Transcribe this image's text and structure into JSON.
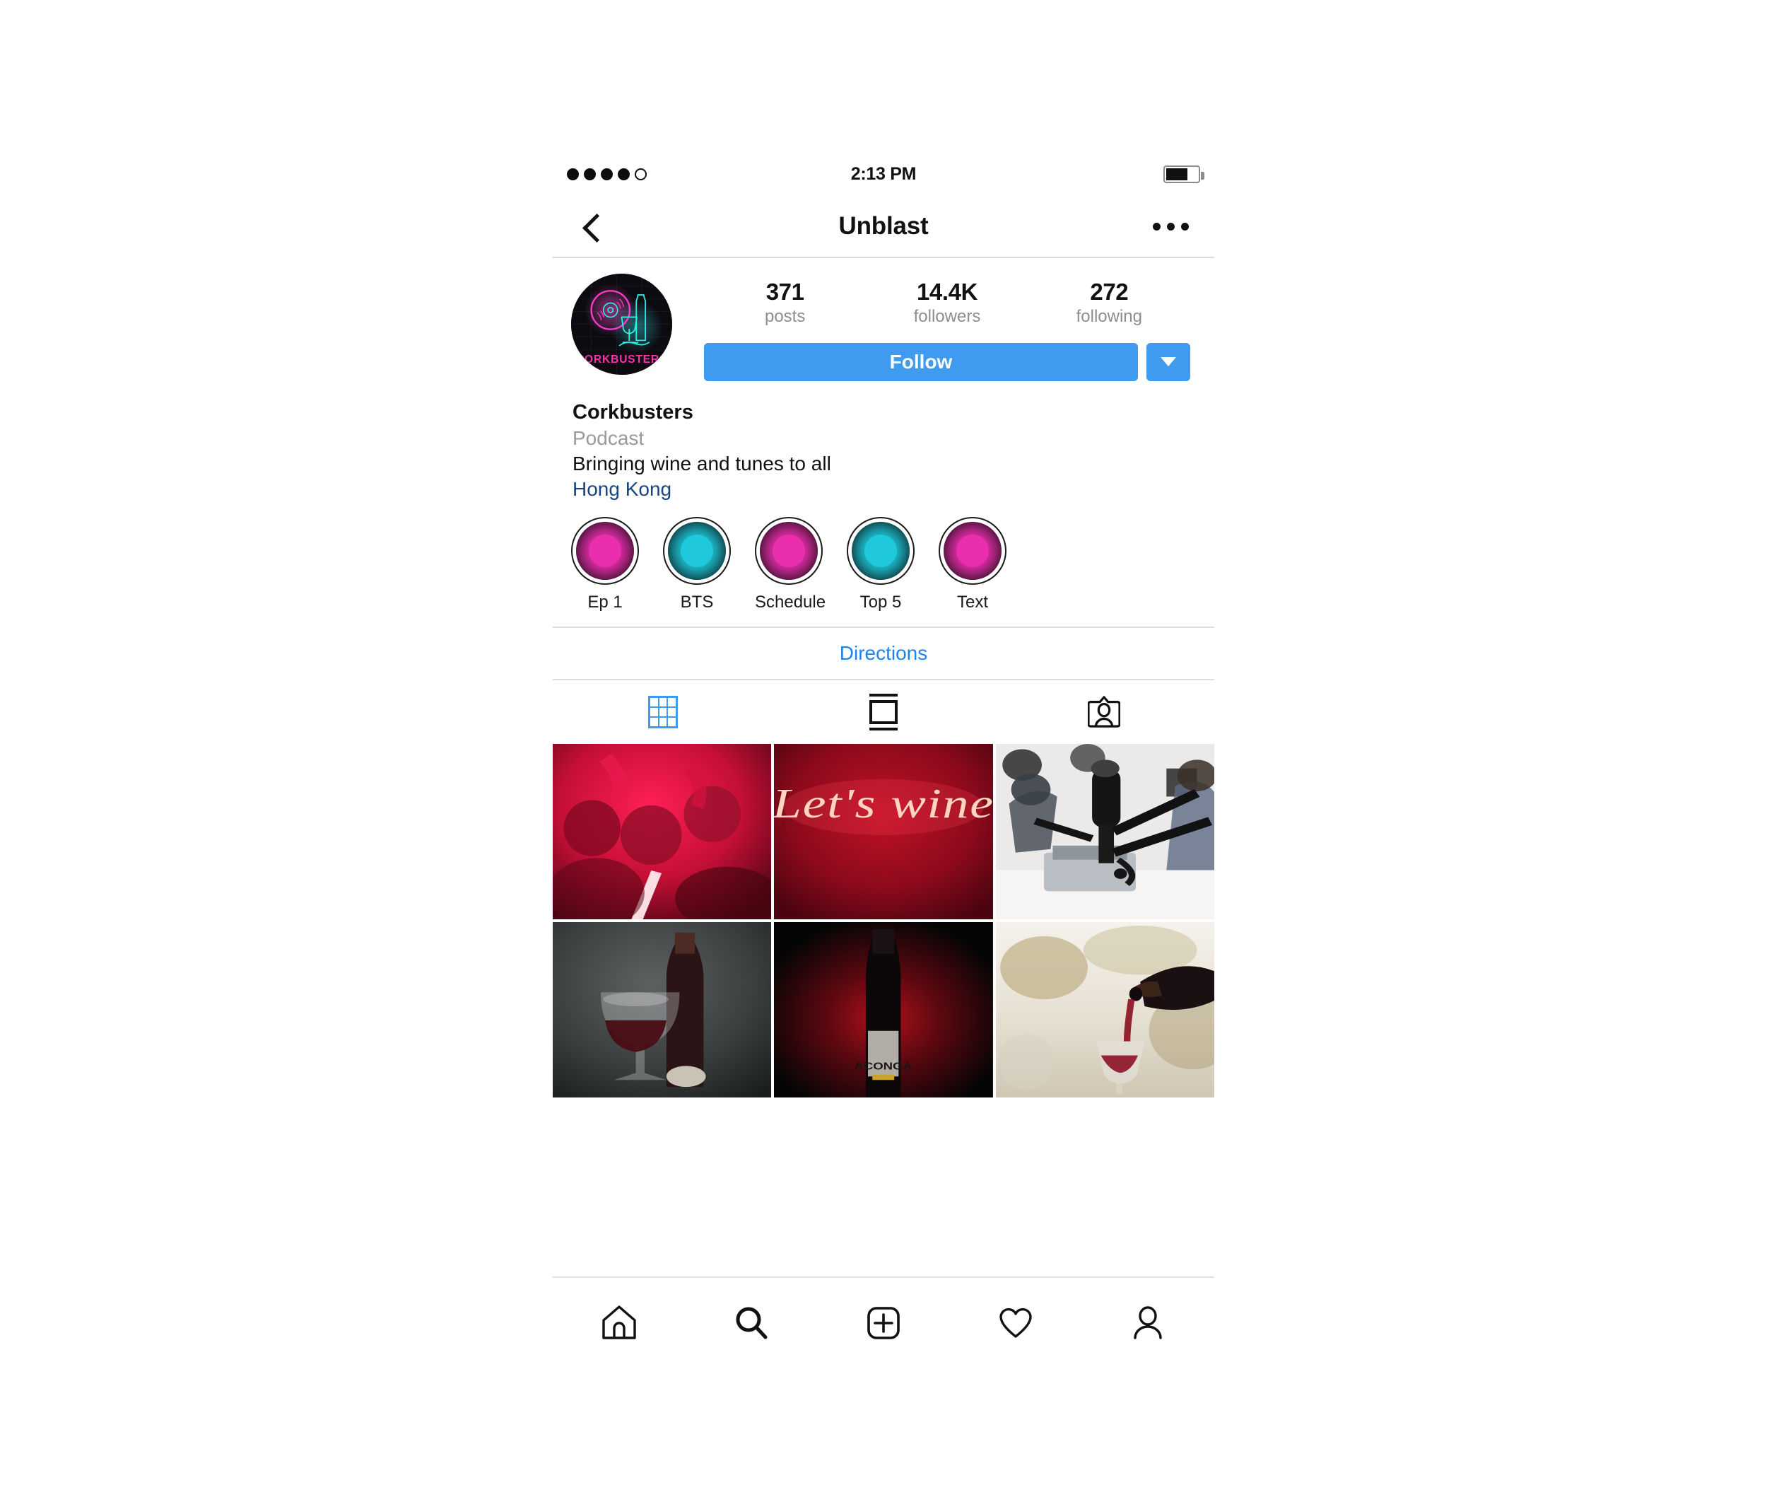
{
  "status_bar": {
    "signal_dots_filled": 4,
    "signal_dots_total": 5,
    "time": "2:13 PM",
    "battery_percent": 62
  },
  "nav_bar": {
    "back_icon": "chevron-left-icon",
    "title": "Unblast",
    "more_icon": "more-horizontal-icon"
  },
  "profile": {
    "avatar_alt": "Corkbusters neon logo",
    "avatar_brand_text": "CORKBUSTERS",
    "stats": [
      {
        "value": "371",
        "label": "posts"
      },
      {
        "value": "14.4K",
        "label": "followers"
      },
      {
        "value": "272",
        "label": "following"
      }
    ],
    "follow_label": "Follow",
    "dropdown_icon": "caret-down-icon",
    "name": "Corkbusters",
    "category": "Podcast",
    "bio": "Bringing wine and tunes to all",
    "location": "Hong Kong"
  },
  "highlights": [
    {
      "label": "Ep 1",
      "color": "#ea2fae"
    },
    {
      "label": "BTS",
      "color": "#1fc8da"
    },
    {
      "label": "Schedule",
      "color": "#ea2fae"
    },
    {
      "label": "Top 5",
      "color": "#1fc8da"
    },
    {
      "label": "Text",
      "color": "#ea2fae"
    }
  ],
  "directions": {
    "label": "Directions"
  },
  "tabs": [
    {
      "name": "grid",
      "icon": "grid-icon",
      "active": true
    },
    {
      "name": "reels",
      "icon": "reels-icon",
      "active": false
    },
    {
      "name": "tagged",
      "icon": "tagged-icon",
      "active": false
    }
  ],
  "posts": [
    {
      "name": "party-crowd-red-light",
      "caption": ""
    },
    {
      "name": "lets-wine-neon-sign",
      "caption": "Let's wine"
    },
    {
      "name": "podcast-studio-microphone",
      "caption": ""
    },
    {
      "name": "wine-glass-and-bottle",
      "caption": ""
    },
    {
      "name": "dark-wine-bottle-red-glow",
      "caption": "ACONGA"
    },
    {
      "name": "pouring-red-wine-outdoors",
      "caption": ""
    }
  ],
  "bottom_nav": [
    {
      "name": "home",
      "icon": "home-icon"
    },
    {
      "name": "search",
      "icon": "search-icon"
    },
    {
      "name": "create",
      "icon": "plus-square-icon"
    },
    {
      "name": "activity",
      "icon": "heart-icon"
    },
    {
      "name": "profile",
      "icon": "person-icon"
    }
  ],
  "colors": {
    "accent_blue": "#3e9bef",
    "link_blue": "#1a84f2",
    "location_blue": "#19447e",
    "muted_gray": "#8e8e8e",
    "neon_pink": "#ea2fae",
    "neon_cyan": "#1fc8da"
  }
}
